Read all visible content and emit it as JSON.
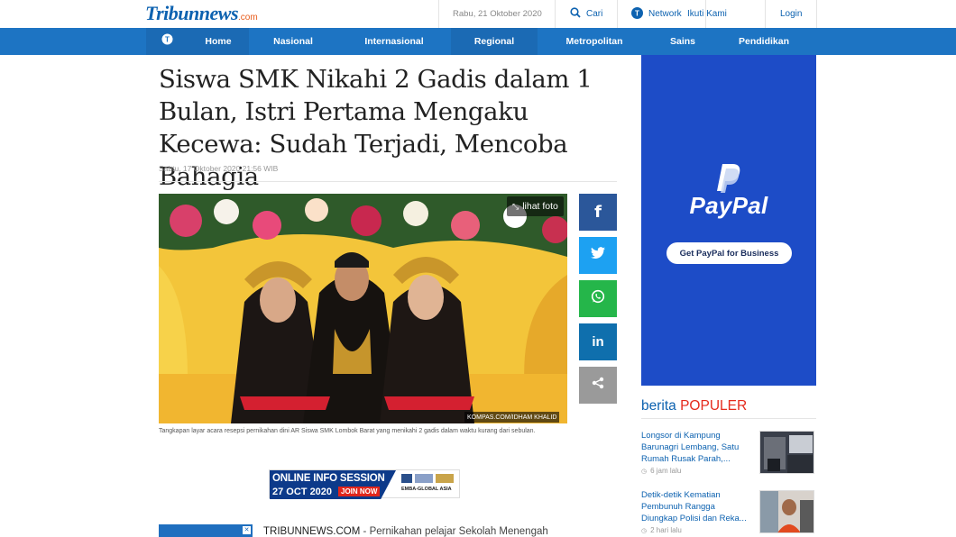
{
  "header": {
    "logo_brand": "Tribun",
    "logo_suffix": "news",
    "logo_dot": ".com",
    "date": "Rabu, 21 Oktober 2020",
    "search_label": "Cari",
    "network_label": "Network",
    "follow_label": "Ikuti Kami",
    "login_label": "Login"
  },
  "nav": {
    "items": [
      {
        "label": "Home"
      },
      {
        "label": "Nasional"
      },
      {
        "label": "Internasional"
      },
      {
        "label": "Regional"
      },
      {
        "label": "Metropolitan"
      },
      {
        "label": "Sains"
      },
      {
        "label": "Pendidikan"
      }
    ]
  },
  "article": {
    "title": "Siswa SMK Nikahi 2 Gadis dalam 1 Bulan, Istri Pertama Mengaku Kecewa: Sudah Terjadi, Mencoba Bahagia",
    "date": "Sabtu, 17 Oktober 2020 21:56 WIB",
    "photo_button": "lihat foto",
    "photo_credit": "KOMPAS.COM/IDHAM KHALID",
    "caption": "Tangkapan layar acara resepsi pernikahan dini AR Siswa SMK Lombok Barat yang menikahi 2 gadis dalam waktu kurang dari sebulan.",
    "source": "TRIBUNNEWS.COM",
    "lead": " - Pernikahan pelajar Sekolah Menengah"
  },
  "share": {
    "facebook": "f",
    "linkedin": "in"
  },
  "banner": {
    "title": "ONLINE INFO SESSION",
    "date": "27 OCT 2020",
    "cta": "JOIN NOW",
    "org": "EMBA-GLOBAL ASIA"
  },
  "sidebar": {
    "paypal_word": "PayPal",
    "paypal_cta": "Get PayPal for Business",
    "popular_prefix": "berita ",
    "popular_highlight": "POPULER",
    "popular_items": [
      {
        "title": "Longsor di Kampung Barunagri Lembang, Satu Rumah Rusak Parah,...",
        "time": "6 jam lalu"
      },
      {
        "title": "Detik-detik Kematian Pembunuh Rangga Diungkap Polisi dan Reka...",
        "time": "2 hari lalu"
      }
    ]
  },
  "colors": {
    "brand_blue": "#0d62b0",
    "nav_blue": "#1d74c3",
    "popular_red": "#e52a1c",
    "paypal_blue": "#1d4cc7"
  }
}
